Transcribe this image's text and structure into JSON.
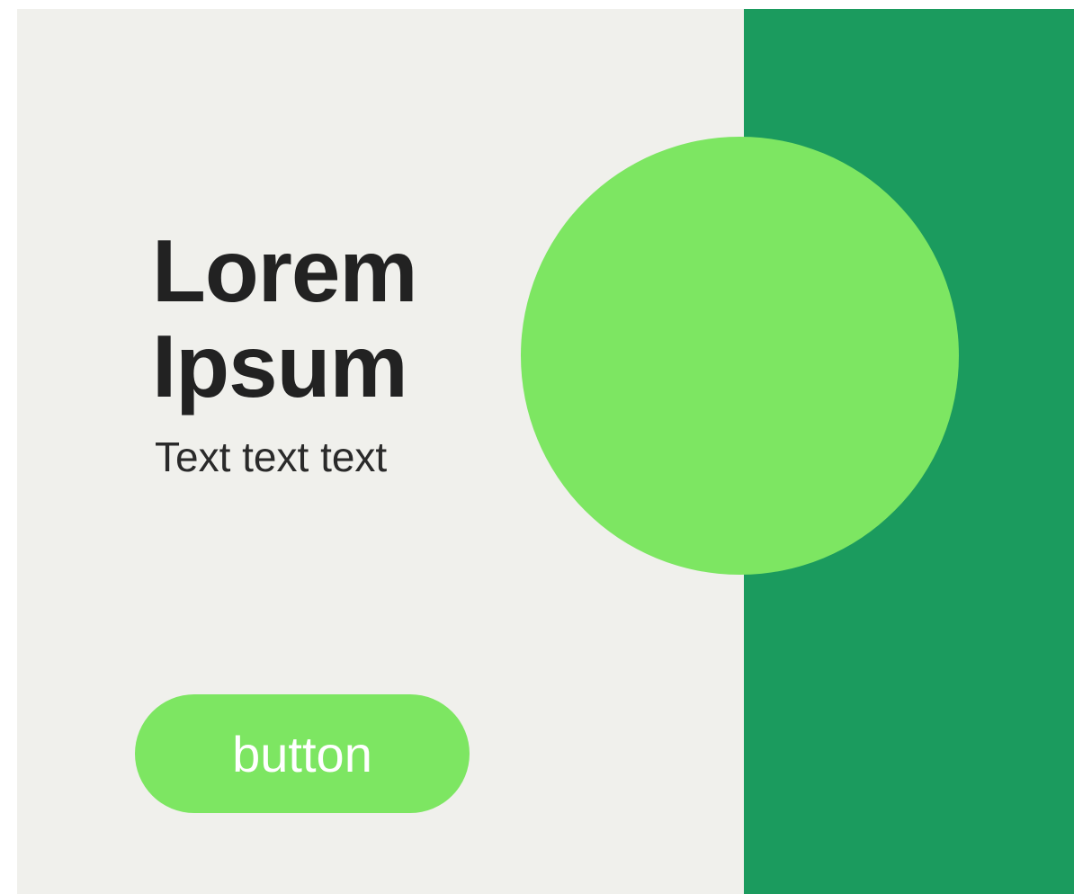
{
  "headline": {
    "line1": "Lorem",
    "line2": "Ipsum"
  },
  "subtext": "Text text text",
  "button": {
    "label": "button"
  },
  "colors": {
    "background": "#f0f0ec",
    "side_panel": "#1b9b5e",
    "accent": "#7de662",
    "text": "#222222",
    "button_text": "#ffffff"
  }
}
